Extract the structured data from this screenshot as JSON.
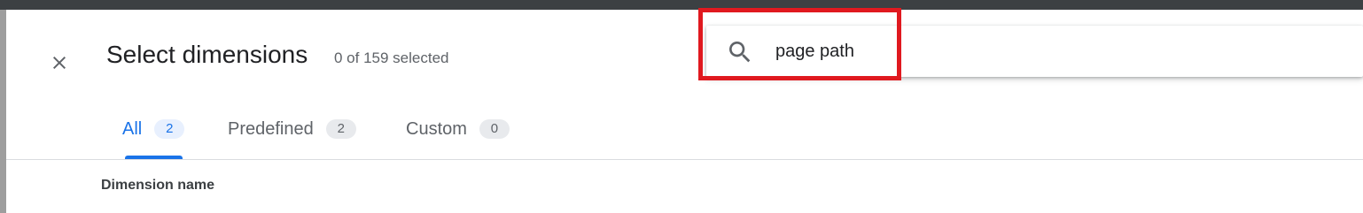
{
  "dialog": {
    "title": "Select dimensions",
    "selected_count": "0 of 159 selected",
    "close_icon": "close-icon"
  },
  "search": {
    "icon": "search-icon",
    "value": "page path",
    "placeholder": ""
  },
  "tabs": [
    {
      "label": "All",
      "count": "2",
      "active": true
    },
    {
      "label": "Predefined",
      "count": "2",
      "active": false
    },
    {
      "label": "Custom",
      "count": "0",
      "active": false
    }
  ],
  "table": {
    "columns": [
      "Dimension name"
    ]
  },
  "colors": {
    "accent": "#1a73e8",
    "highlight": "#e0191f",
    "topbar": "#3c4043"
  }
}
